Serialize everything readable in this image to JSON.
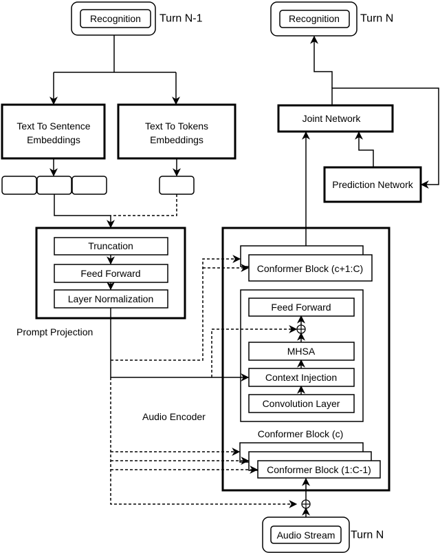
{
  "top_left": {
    "recognition": "Recognition",
    "turn": "Turn N-1"
  },
  "top_right": {
    "recognition": "Recognition",
    "turn": "Turn N"
  },
  "sentence_embeddings": {
    "line1": "Text To Sentence",
    "line2": "Embeddings"
  },
  "token_embeddings": {
    "line1": "Text To Tokens",
    "line2": "Embeddings"
  },
  "prompt_projection": {
    "label": "Prompt Projection",
    "truncation": "Truncation",
    "feed_forward": "Feed Forward",
    "layer_norm": "Layer Normalization"
  },
  "audio_encoder": {
    "label": "Audio Encoder",
    "conformer_upper": "Conformer Block (c+1:C)",
    "block_c_label": "Conformer Block (c)",
    "feed_forward": "Feed Forward",
    "mhsa": "MHSA",
    "context_injection": "Context Injection",
    "convolution": "Convolution Layer",
    "conformer_lower": "Conformer Block (1:C-1)"
  },
  "joint_network": "Joint Network",
  "prediction_network": "Prediction Network",
  "audio_stream": {
    "label": "Audio Stream",
    "turn": "Turn N"
  }
}
